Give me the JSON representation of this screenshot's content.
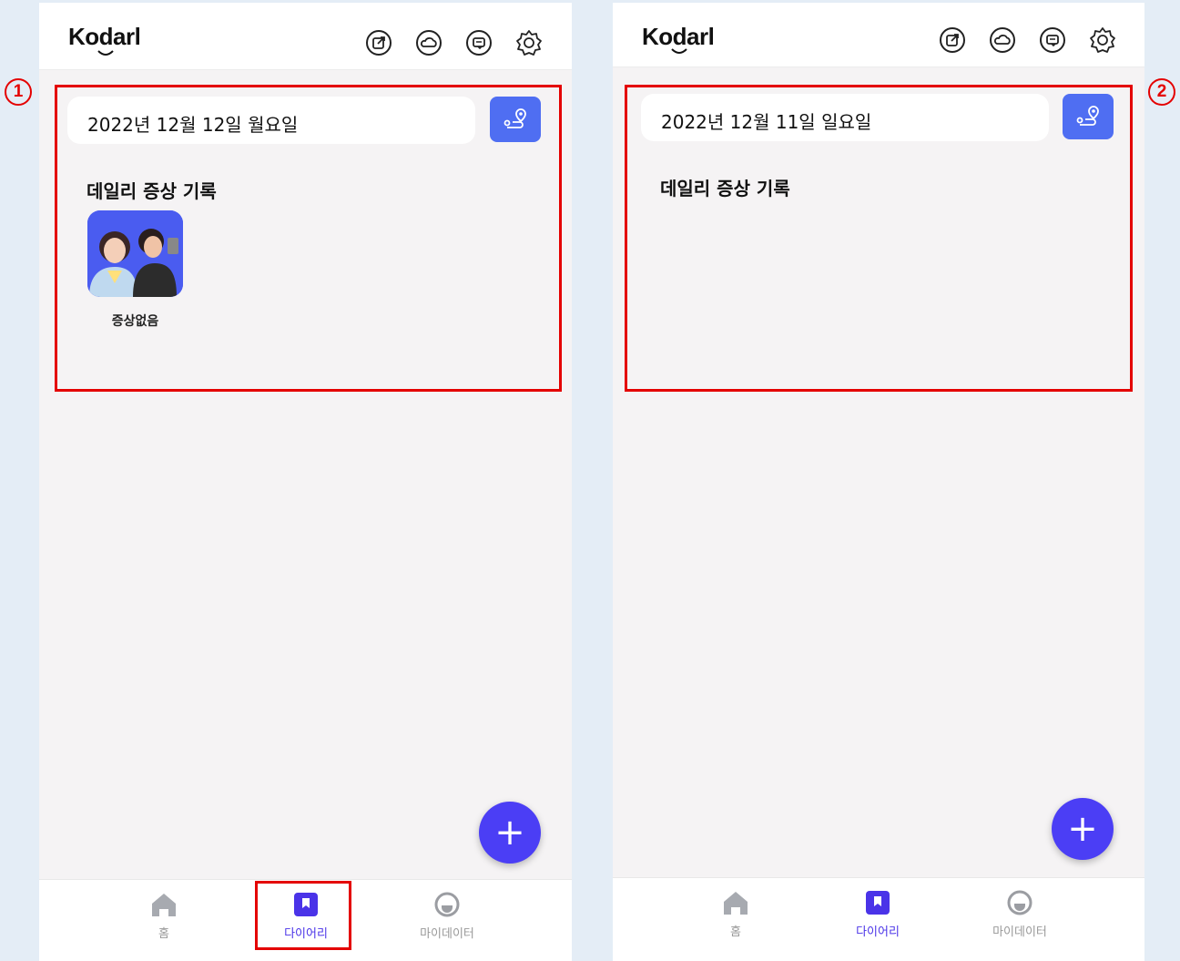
{
  "app": {
    "logo": "Kodarl"
  },
  "screens": [
    {
      "marker": "1",
      "date": "2022년 12월 12일 월요일",
      "section_title": "데일리 증상 기록",
      "symptoms": [
        {
          "label": "증상없음"
        }
      ],
      "fab": "+"
    },
    {
      "marker": "2",
      "date": "2022년 12월 11일 일요일",
      "section_title": "데일리 증상 기록",
      "symptoms": [],
      "fab": "+"
    }
  ],
  "bottom_nav": {
    "items": [
      {
        "label": "홈",
        "icon": "home-icon",
        "active": false
      },
      {
        "label": "다이어리",
        "icon": "diary-bookmark-icon",
        "active": true
      },
      {
        "label": "마이데이터",
        "icon": "mydata-icon",
        "active": false
      }
    ]
  },
  "header_icons": [
    "share-icon",
    "cloud-icon",
    "chat-icon",
    "gear-icon"
  ],
  "colors": {
    "accent": "#4b3ef5",
    "route_button": "#4f6ef2",
    "highlight": "#e40000",
    "nav_active": "#4a33e8"
  }
}
